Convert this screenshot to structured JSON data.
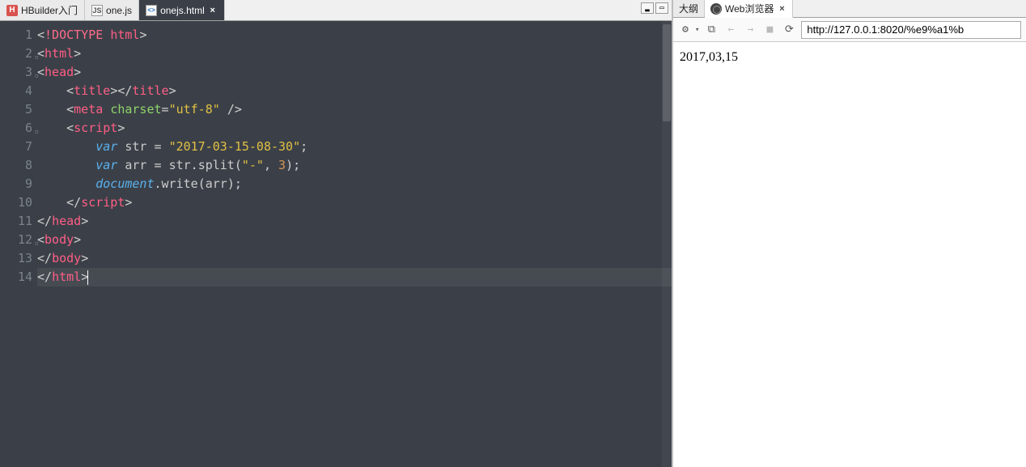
{
  "editor": {
    "tabs": [
      {
        "label": "HBuilder入门",
        "active": false,
        "closable": false
      },
      {
        "label": "one.js",
        "active": false,
        "closable": true
      },
      {
        "label": "onejs.html",
        "active": true,
        "closable": true
      }
    ],
    "window_buttons": {
      "minimize": "▂",
      "maximize": "▭"
    },
    "code_lines": [
      {
        "num": "1",
        "fold": "",
        "tokens": [
          [
            "angle",
            "<"
          ],
          [
            "doctype",
            "!DOCTYPE"
          ],
          [
            "punc",
            " "
          ],
          [
            "tag",
            "html"
          ],
          [
            "angle",
            ">"
          ]
        ]
      },
      {
        "num": "2",
        "fold": "▫",
        "tokens": [
          [
            "angle",
            "<"
          ],
          [
            "tag",
            "html"
          ],
          [
            "angle",
            ">"
          ]
        ]
      },
      {
        "num": "3",
        "fold": "▫",
        "tokens": [
          [
            "angle",
            "<"
          ],
          [
            "tag",
            "head"
          ],
          [
            "angle",
            ">"
          ]
        ]
      },
      {
        "num": "4",
        "fold": "",
        "tokens": [
          [
            "punc",
            "    "
          ],
          [
            "angle",
            "<"
          ],
          [
            "tag",
            "title"
          ],
          [
            "angle",
            ">"
          ],
          [
            "angle",
            "</"
          ],
          [
            "tag",
            "title"
          ],
          [
            "angle",
            ">"
          ]
        ]
      },
      {
        "num": "5",
        "fold": "",
        "tokens": [
          [
            "punc",
            "    "
          ],
          [
            "angle",
            "<"
          ],
          [
            "tag",
            "meta"
          ],
          [
            "punc",
            " "
          ],
          [
            "attr",
            "charset"
          ],
          [
            "punc",
            "="
          ],
          [
            "str",
            "\"utf-8\""
          ],
          [
            "punc",
            " "
          ],
          [
            "angle",
            "/>"
          ]
        ]
      },
      {
        "num": "6",
        "fold": "▫",
        "tokens": [
          [
            "punc",
            "    "
          ],
          [
            "angle",
            "<"
          ],
          [
            "tag",
            "script"
          ],
          [
            "angle",
            ">"
          ]
        ]
      },
      {
        "num": "7",
        "fold": "",
        "tokens": [
          [
            "punc",
            "        "
          ],
          [
            "kw",
            "var"
          ],
          [
            "punc",
            " "
          ],
          [
            "ident",
            "str"
          ],
          [
            "punc",
            " = "
          ],
          [
            "str",
            "\"2017-03-15-08-30\""
          ],
          [
            "punc",
            ";"
          ]
        ]
      },
      {
        "num": "8",
        "fold": "",
        "tokens": [
          [
            "punc",
            "        "
          ],
          [
            "kw",
            "var"
          ],
          [
            "punc",
            " "
          ],
          [
            "ident",
            "arr"
          ],
          [
            "punc",
            " = "
          ],
          [
            "ident",
            "str"
          ],
          [
            "punc",
            "."
          ],
          [
            "func",
            "split"
          ],
          [
            "punc",
            "("
          ],
          [
            "str",
            "\"-\""
          ],
          [
            "punc",
            ", "
          ],
          [
            "num",
            "3"
          ],
          [
            "punc",
            ");"
          ]
        ]
      },
      {
        "num": "9",
        "fold": "",
        "tokens": [
          [
            "punc",
            "        "
          ],
          [
            "obj",
            "document"
          ],
          [
            "punc",
            "."
          ],
          [
            "func",
            "write"
          ],
          [
            "punc",
            "("
          ],
          [
            "ident",
            "arr"
          ],
          [
            "punc",
            ");"
          ]
        ]
      },
      {
        "num": "10",
        "fold": "",
        "tokens": [
          [
            "punc",
            "    "
          ],
          [
            "angle",
            "</"
          ],
          [
            "tag",
            "script"
          ],
          [
            "angle",
            ">"
          ]
        ]
      },
      {
        "num": "11",
        "fold": "",
        "tokens": [
          [
            "angle",
            "</"
          ],
          [
            "tag",
            "head"
          ],
          [
            "angle",
            ">"
          ]
        ]
      },
      {
        "num": "12",
        "fold": "▫",
        "tokens": [
          [
            "angle",
            "<"
          ],
          [
            "tag",
            "body"
          ],
          [
            "angle",
            ">"
          ]
        ]
      },
      {
        "num": "13",
        "fold": "",
        "tokens": [
          [
            "angle",
            "</"
          ],
          [
            "tag",
            "body"
          ],
          [
            "angle",
            ">"
          ]
        ]
      },
      {
        "num": "14",
        "fold": "",
        "tokens": [
          [
            "angle",
            "</"
          ],
          [
            "tag",
            "html"
          ],
          [
            "angle",
            ">"
          ]
        ],
        "cursor": true
      }
    ]
  },
  "right": {
    "tabs": [
      {
        "label": "大纲",
        "active": false,
        "closable": false
      },
      {
        "label": "Web浏览器",
        "active": true,
        "closable": true
      }
    ],
    "toolbar": {
      "gear": "⚙",
      "terminal": "⧉",
      "back": "←",
      "forward": "→",
      "stop": "■",
      "refresh": "⟳"
    },
    "url": "http://127.0.0.1:8020/%e9%a1%b",
    "output": "2017,03,15"
  }
}
